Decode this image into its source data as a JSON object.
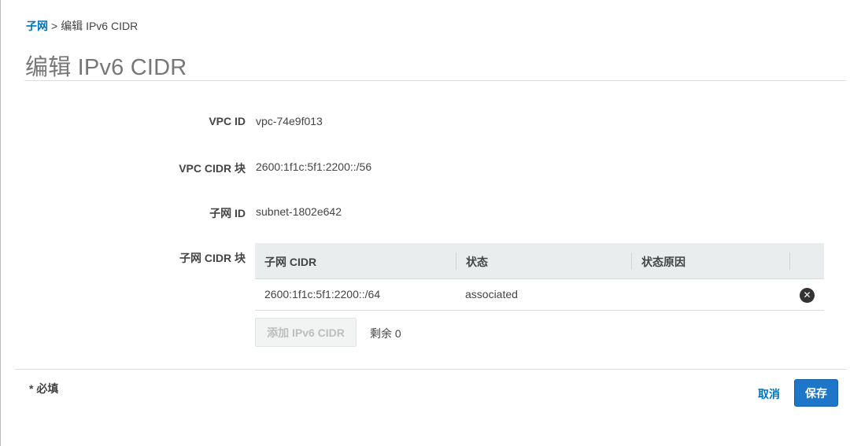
{
  "breadcrumb": {
    "parent": "子网",
    "separator": ">",
    "current": "编辑 IPv6 CIDR"
  },
  "page": {
    "title": "编辑 IPv6 CIDR"
  },
  "fields": {
    "vpc_id": {
      "label": "VPC ID",
      "value": "vpc-74e9f013"
    },
    "vpc_cidr": {
      "label": "VPC CIDR 块",
      "value": "2600:1f1c:5f1:2200::/56"
    },
    "subnet_id": {
      "label": "子网 ID",
      "value": "subnet-1802e642"
    },
    "subnet_cidr": {
      "label": "子网 CIDR 块"
    }
  },
  "cidr_table": {
    "columns": [
      "子网 CIDR",
      "状态",
      "状态原因"
    ],
    "rows": [
      {
        "cidr": "2600:1f1c:5f1:2200::/64",
        "status": "associated",
        "reason": ""
      }
    ]
  },
  "add_button": {
    "label": "添加 IPv6 CIDR",
    "enabled": false
  },
  "remaining": "剩余 0",
  "footer": {
    "required_note": "* 必填",
    "cancel_label": "取消",
    "save_label": "保存"
  },
  "colors": {
    "link": "#0073bb",
    "primary": "#1e76c8",
    "header_bg": "#eaeded"
  },
  "icons": {
    "remove": "close-circle-icon"
  }
}
